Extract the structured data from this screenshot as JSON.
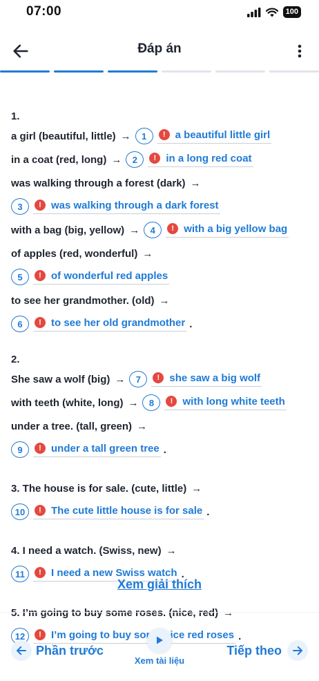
{
  "status": {
    "time": "07:00",
    "battery": "100"
  },
  "header": {
    "title": "Đáp án"
  },
  "progress": {
    "total_segments": 6,
    "completed_segments": 3
  },
  "exercises": [
    {
      "number": "1.",
      "items": [
        {
          "prompt": "a girl (beautiful, little)",
          "arrow": "→",
          "badge": "1",
          "answer": "a beautiful little girl",
          "wrapped": false,
          "dot": ""
        },
        {
          "prompt": "in a coat (red, long)",
          "arrow": "→",
          "badge": "2",
          "answer": "in a long red coat",
          "wrapped": false,
          "dot": ""
        },
        {
          "prompt": "was walking through a forest (dark)",
          "arrow": "→",
          "badge": "3",
          "answer": "was walking through a dark forest",
          "wrapped": true,
          "dot": ""
        },
        {
          "prompt": "with a bag (big, yellow)",
          "arrow": "→",
          "badge": "4",
          "answer": "with a big yellow bag",
          "wrapped": false,
          "dot": ""
        },
        {
          "prompt": "of apples (red, wonderful)",
          "arrow": "→",
          "badge": "5",
          "answer": "of wonderful red apples",
          "wrapped": true,
          "dot": ""
        },
        {
          "prompt": "to see her grandmother. (old)",
          "arrow": "→",
          "badge": "6",
          "answer": "to see her old grandmother",
          "wrapped": true,
          "dot": "."
        }
      ]
    },
    {
      "number": "2.",
      "items": [
        {
          "prompt": "She saw a wolf (big)",
          "arrow": "→",
          "badge": "7",
          "answer": "she saw a big wolf",
          "wrapped": false,
          "dot": ""
        },
        {
          "prompt": "with teeth (white, long)",
          "arrow": "→",
          "badge": "8",
          "answer": "with long white teeth",
          "wrapped": false,
          "dot": ""
        },
        {
          "prompt": "under a tree. (tall, green)",
          "arrow": "→",
          "badge": "9",
          "answer": "under a tall green tree",
          "wrapped": true,
          "dot": "."
        }
      ]
    },
    {
      "number": "",
      "items": [
        {
          "prompt": "3.  The house is for sale. (cute, little)",
          "arrow": "→",
          "badge": "10",
          "answer": "The cute little house is for sale",
          "wrapped": true,
          "dot": "."
        }
      ]
    },
    {
      "number": "",
      "items": [
        {
          "prompt": "4. I need a watch. (Swiss, new)",
          "arrow": "→",
          "badge": "11",
          "answer": "I need a new Swiss watch",
          "wrapped": true,
          "dot": "."
        }
      ]
    },
    {
      "number": "",
      "items": [
        {
          "prompt": "5. I’m going to buy some roses. (nice, red)",
          "arrow": "→",
          "badge": "12",
          "answer": "I’m going to buy some nice red roses",
          "wrapped": true,
          "dot": "."
        }
      ]
    }
  ],
  "footer": {
    "explain_link": "Xem giải thích",
    "prev_label": "Phần trước",
    "next_label": "Tiếp theo",
    "doc_label": "Xem tài liệu"
  },
  "icons": {
    "error": "!",
    "back": "arrow-left-icon",
    "next": "arrow-right-icon",
    "more": "more-vertical-icon",
    "play": "play-icon"
  },
  "colors": {
    "accent": "#1f7ad6",
    "error": "#e5483f",
    "text": "#1f2430"
  }
}
